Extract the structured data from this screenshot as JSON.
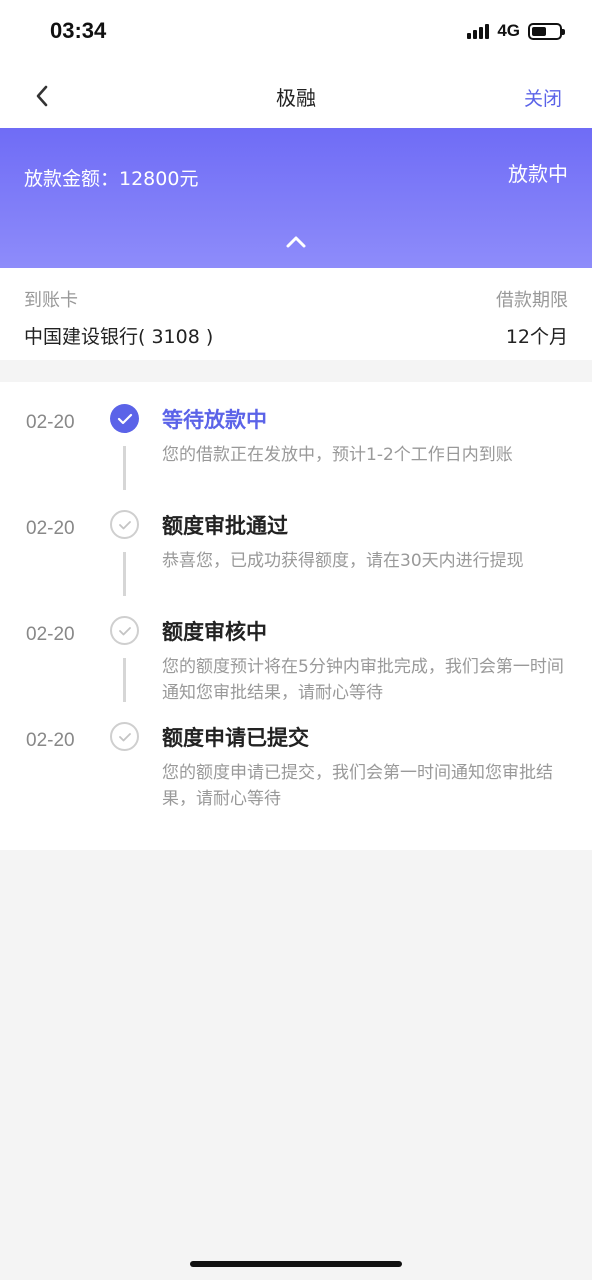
{
  "status_bar": {
    "time": "03:34",
    "network": "4G"
  },
  "nav": {
    "title": "极融",
    "close_label": "关闭"
  },
  "banner": {
    "amount_text": "放款金额：12800元",
    "status": "放款中"
  },
  "card": {
    "card_label": "到账卡",
    "card_value": "中国建设银行( 3108 )",
    "term_label": "借款期限",
    "term_value": "12个月"
  },
  "timeline": [
    {
      "date": "02-20",
      "title": "等待放款中",
      "desc": "您的借款正在发放中，预计1-2个工作日内到账",
      "state": "active"
    },
    {
      "date": "02-20",
      "title": "额度审批通过",
      "desc": "恭喜您，已成功获得额度，请在30天内进行提现",
      "state": "done"
    },
    {
      "date": "02-20",
      "title": "额度审核中",
      "desc": "您的额度预计将在5分钟内审批完成，我们会第一时间通知您审批结果，请耐心等待",
      "state": "done"
    },
    {
      "date": "02-20",
      "title": "额度申请已提交",
      "desc": "您的额度申请已提交，我们会第一时间通知您审批结果，请耐心等待",
      "state": "done"
    }
  ],
  "colors": {
    "accent": "#5b63e8",
    "banner_top": "#6f6cf6",
    "banner_bottom": "#8e8cfa"
  }
}
